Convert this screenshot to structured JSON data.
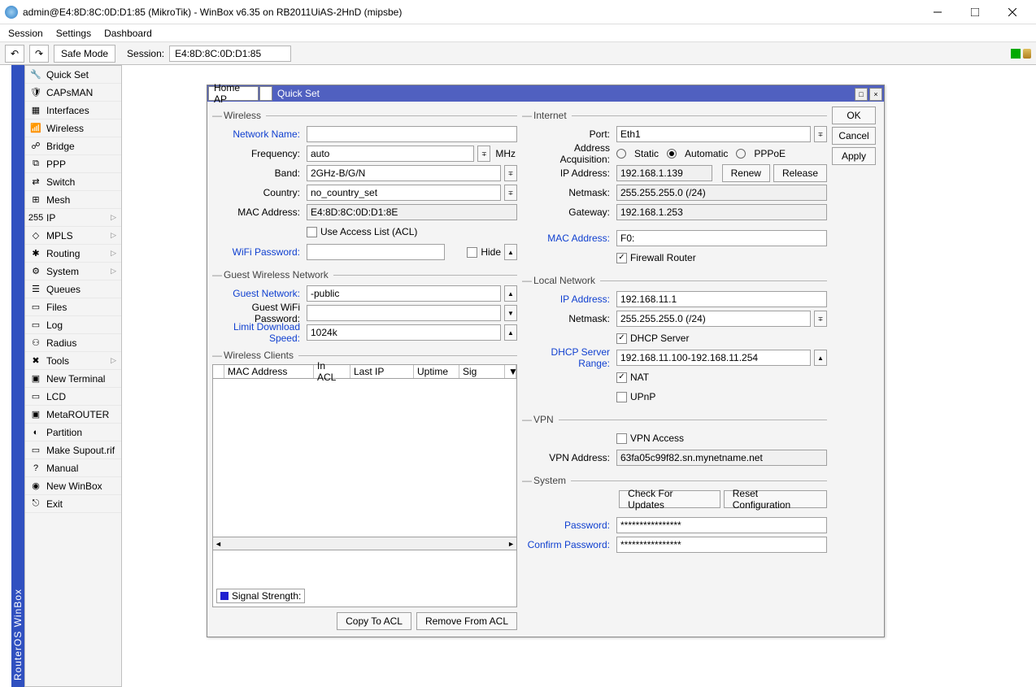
{
  "window": {
    "title": "admin@E4:8D:8C:0D:D1:85 (MikroTik) - WinBox v6.35 on RB2011UiAS-2HnD (mipsbe)"
  },
  "menubar": [
    "Session",
    "Settings",
    "Dashboard"
  ],
  "toolbar": {
    "safe_mode": "Safe Mode",
    "session_label": "Session:",
    "session_value": "E4:8D:8C:0D:D1:85"
  },
  "vstrip": "RouterOS WinBox",
  "sidebar": [
    {
      "label": "Quick Set",
      "icon": "🔧"
    },
    {
      "label": "CAPsMAN",
      "icon": "🛡"
    },
    {
      "label": "Interfaces",
      "icon": "▦"
    },
    {
      "label": "Wireless",
      "icon": "📶"
    },
    {
      "label": "Bridge",
      "icon": "☍"
    },
    {
      "label": "PPP",
      "icon": "⧉"
    },
    {
      "label": "Switch",
      "icon": "⇄"
    },
    {
      "label": "Mesh",
      "icon": "⊞"
    },
    {
      "label": "IP",
      "icon": "255",
      "arrow": true
    },
    {
      "label": "MPLS",
      "icon": "◇",
      "arrow": true
    },
    {
      "label": "Routing",
      "icon": "✱",
      "arrow": true
    },
    {
      "label": "System",
      "icon": "⚙",
      "arrow": true
    },
    {
      "label": "Queues",
      "icon": "☰"
    },
    {
      "label": "Files",
      "icon": "▭"
    },
    {
      "label": "Log",
      "icon": "▭"
    },
    {
      "label": "Radius",
      "icon": "⚇"
    },
    {
      "label": "Tools",
      "icon": "✖",
      "arrow": true
    },
    {
      "label": "New Terminal",
      "icon": "▣"
    },
    {
      "label": "LCD",
      "icon": "▭"
    },
    {
      "label": "MetaROUTER",
      "icon": "▣"
    },
    {
      "label": "Partition",
      "icon": "◐"
    },
    {
      "label": "Make Supout.rif",
      "icon": "▭"
    },
    {
      "label": "Manual",
      "icon": "?"
    },
    {
      "label": "New WinBox",
      "icon": "◉"
    },
    {
      "label": "Exit",
      "icon": "⎋"
    }
  ],
  "dialog": {
    "mode": "Home AP",
    "title": "Quick Set",
    "right_buttons": {
      "ok": "OK",
      "cancel": "Cancel",
      "apply": "Apply"
    },
    "wireless": {
      "caption": "Wireless",
      "network_name_label": "Network Name:",
      "network_name": "",
      "frequency_label": "Frequency:",
      "frequency": "auto",
      "frequency_unit": "MHz",
      "band_label": "Band:",
      "band": "2GHz-B/G/N",
      "country_label": "Country:",
      "country": "no_country_set",
      "mac_label": "MAC Address:",
      "mac": "E4:8D:8C:0D:D1:8E",
      "acl_label": "Use Access List (ACL)",
      "wifi_pw_label": "WiFi Password:",
      "wifi_pw": "",
      "hide_label": "Hide"
    },
    "guest": {
      "caption": "Guest Wireless Network",
      "network_label": "Guest Network:",
      "network": "        -public",
      "pw_label": "Guest WiFi Password:",
      "pw": "",
      "limit_label": "Limit Download Speed:",
      "limit": "1024k"
    },
    "clients": {
      "caption": "Wireless Clients",
      "cols": {
        "mac": "MAC Address",
        "acl": "In ACL",
        "lastip": "Last IP",
        "uptime": "Uptime",
        "sig": "Sig"
      },
      "signal_label": "Signal Strength:",
      "copy": "Copy To ACL",
      "remove": "Remove From ACL"
    },
    "internet": {
      "caption": "Internet",
      "port_label": "Port:",
      "port": "Eth1",
      "acq_label": "Address Acquisition:",
      "acq_static": "Static",
      "acq_auto": "Automatic",
      "acq_pppoe": "PPPoE",
      "ip_label": "IP Address:",
      "ip": "192.168.1.139",
      "renew": "Renew",
      "release": "Release",
      "netmask_label": "Netmask:",
      "netmask": "255.255.255.0 (/24)",
      "gateway_label": "Gateway:",
      "gateway": "192.168.1.253",
      "mac_label": "MAC Address:",
      "mac": "F0:",
      "fw_label": "Firewall Router"
    },
    "local": {
      "caption": "Local Network",
      "ip_label": "IP Address:",
      "ip": "192.168.11.1",
      "netmask_label": "Netmask:",
      "netmask": "255.255.255.0 (/24)",
      "dhcp_label": "DHCP Server",
      "range_label": "DHCP Server Range:",
      "range": "192.168.11.100-192.168.11.254",
      "nat_label": "NAT",
      "upnp_label": "UPnP"
    },
    "vpn": {
      "caption": "VPN",
      "access_label": "VPN Access",
      "addr_label": "VPN Address:",
      "addr": "63fa05c99f82.sn.mynetname.net"
    },
    "system": {
      "caption": "System",
      "check": "Check For Updates",
      "reset": "Reset Configuration",
      "pw_label": "Password:",
      "pw": "****************",
      "cpw_label": "Confirm Password:",
      "cpw": "****************"
    }
  }
}
